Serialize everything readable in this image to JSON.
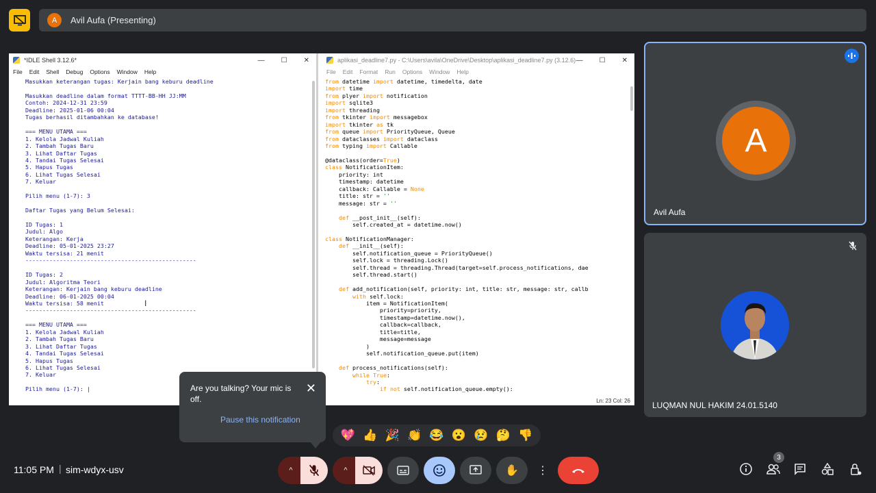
{
  "presenter": {
    "avatar_letter": "A",
    "label": "Avil Aufa (Presenting)"
  },
  "shell": {
    "title": "*IDLE Shell 3.12.6*",
    "menu": [
      "File",
      "Edit",
      "Shell",
      "Debug",
      "Options",
      "Window",
      "Help"
    ],
    "lines": [
      "Masukkan keterangan tugas: Kerjain bang keburu deadline",
      "",
      "Masukkan deadline dalam format TTTT-BB-HH JJ:MM",
      "Contoh: 2024-12-31 23:59",
      "Deadline: 2025-01-06 00:04",
      "Tugas berhasil ditambahkan ke database!",
      "",
      "=== MENU UTAMA ===",
      "1. Kelola Jadwal Kuliah",
      "2. Tambah Tugas Baru",
      "3. Lihat Daftar Tugas",
      "4. Tandai Tugas Selesai",
      "5. Hapus Tugas",
      "6. Lihat Tugas Selesai",
      "7. Keluar",
      "",
      "Pilih menu (1-7): 3",
      "",
      "Daftar Tugas yang Belum Selesai:",
      "",
      "ID Tugas: 1",
      "Judul: Algo",
      "Keterangan: Kerja",
      "Deadline: 05-01-2025 23:27",
      "Waktu tersisa: 21 menit",
      "--------------------------------------------------",
      "",
      "ID Tugas: 2",
      "Judul: Algoritma Teori",
      "Keterangan: Kerjain bang keburu deadline",
      "Deadline: 06-01-2025 00:04",
      "Waktu tersisa: 58 menit",
      "--------------------------------------------------",
      "",
      "=== MENU UTAMA ===",
      "1. Kelola Jadwal Kuliah",
      "2. Tambah Tugas Baru",
      "3. Lihat Daftar Tugas",
      "4. Tandai Tugas Selesai",
      "5. Hapus Tugas",
      "6. Lihat Tugas Selesai",
      "7. Keluar",
      "",
      "Pilih menu (1-7): |"
    ]
  },
  "editor": {
    "title": "aplikasi_deadline7.py - C:\\Users\\avila\\OneDrive\\Desktop\\aplikasi_deadline7.py (3.12.6)",
    "menu": [
      "File",
      "Edit",
      "Format",
      "Run",
      "Options",
      "Window",
      "Help"
    ],
    "status": "Ln: 23   Col: 26",
    "lines": [
      "from datetime import datetime, timedelta, date",
      "import time",
      "from plyer import notification",
      "import sqlite3",
      "import threading",
      "from tkinter import messagebox",
      "import tkinter as tk",
      "from queue import PriorityQueue, Queue",
      "from dataclasses import dataclass",
      "from typing import Callable",
      "",
      "@dataclass(order=True)",
      "class NotificationItem:",
      "    priority: int",
      "    timestamp: datetime",
      "    callback: Callable = None",
      "    title: str = ''",
      "    message: str = ''",
      "",
      "    def __post_init__(self):",
      "        self.created_at = datetime.now()",
      "",
      "class NotificationManager:",
      "    def __init__(self):",
      "        self.notification_queue = PriorityQueue()",
      "        self.lock = threading.Lock()",
      "        self.thread = threading.Thread(target=self.process_notifications, dae",
      "        self.thread.start()",
      "",
      "    def add_notification(self, priority: int, title: str, message: str, callb",
      "        with self.lock:",
      "            item = NotificationItem(",
      "                priority=priority,",
      "                timestamp=datetime.now(),",
      "                callback=callback,",
      "                title=title,",
      "                message=message",
      "            )",
      "            self.notification_queue.put(item)",
      "",
      "    def process_notifications(self):",
      "        while True:",
      "            try:",
      "                if not self.notification_queue.empty():"
    ]
  },
  "tiles": {
    "tile1": {
      "avatar_letter": "A",
      "name": "Avil Aufa"
    },
    "tile2": {
      "name": "LUQMAN NUL HAKIM 24.01.5140"
    }
  },
  "notification": {
    "text": "Are you talking? Your mic is off.",
    "close": "✕",
    "action": "Pause this notification"
  },
  "reactions": [
    "💖",
    "👍",
    "🎉",
    "👏",
    "😂",
    "😮",
    "😢",
    "🤔",
    "👎"
  ],
  "bottom": {
    "time": "11:05 PM",
    "separator": "|",
    "meeting_code": "sim-wdyx-usv",
    "people_count": "3"
  },
  "colors": {
    "accent": "#8ab4f8",
    "end_call": "#ea4335",
    "mic_off_bg": "#f9dedc",
    "present_icon": "#fbbc04"
  }
}
